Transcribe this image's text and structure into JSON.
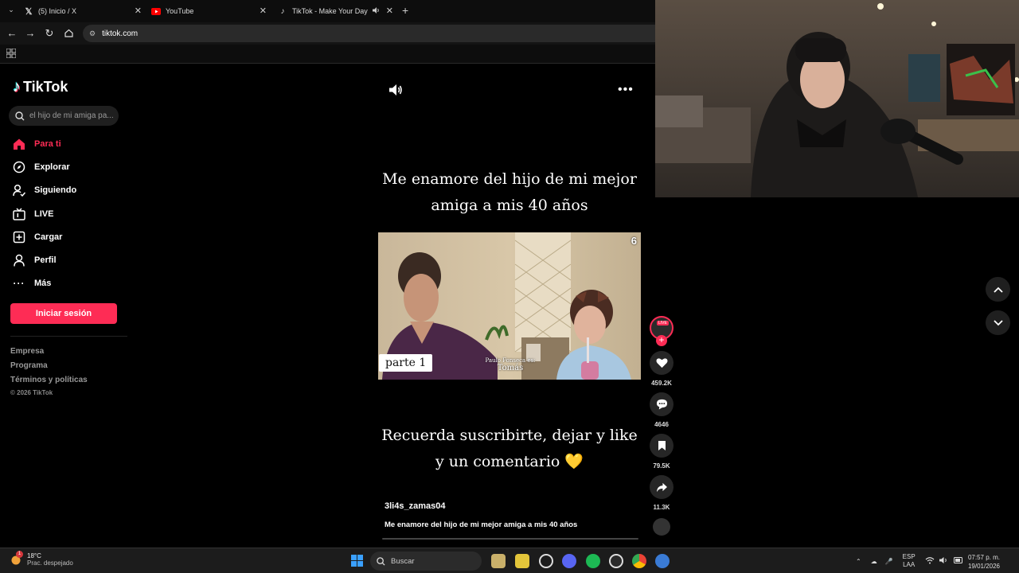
{
  "browser": {
    "tabs": [
      {
        "title": "(5) Inicio / X",
        "icon": "x-logo-icon"
      },
      {
        "title": "YouTube",
        "icon": "youtube-logo-icon"
      },
      {
        "title": "TikTok - Make Your Day",
        "icon": "tiktok-logo-icon",
        "active": true
      }
    ],
    "url": "tiktok.com"
  },
  "tiktok": {
    "brand": "TikTok",
    "search_placeholder": "el hijo de mi amiga pa...",
    "nav": [
      {
        "label": "Para ti",
        "icon": "home-icon",
        "active": true
      },
      {
        "label": "Explorar",
        "icon": "compass-icon"
      },
      {
        "label": "Siguiendo",
        "icon": "following-icon"
      },
      {
        "label": "LIVE",
        "icon": "live-tv-icon"
      },
      {
        "label": "Cargar",
        "icon": "upload-plus-icon"
      },
      {
        "label": "Perfil",
        "icon": "person-icon"
      },
      {
        "label": "Más",
        "icon": "more-dots-icon"
      }
    ],
    "login_label": "Iniciar sesión",
    "footer_links": [
      "Empresa",
      "Programa",
      "Términos y políticas"
    ],
    "copyright": "© 2026 TikTok"
  },
  "video": {
    "caption_top": "Me enamore del hijo de mi mejor amiga a mis 40 años",
    "caption_bottom": "Recuerda suscribirte, dejar y like y un comentario 💛",
    "part_label": "parte 1",
    "credit_line1": "Paulo Fonseca es:",
    "credit_line2": "Tomás",
    "channel_logo": "6",
    "username": "3li4s_zamas04",
    "description": "Me enamore del hijo de mi mejor amiga a mis 40 años",
    "avatar_badge": "LIVE",
    "likes": "459.2K",
    "comments": "4646",
    "saves": "79.5K",
    "shares": "11.3K"
  },
  "taskbar": {
    "temperature": "18°C",
    "weather": "Prac. despejado",
    "weather_badge": "1",
    "search_label": "Buscar",
    "language_top": "ESP",
    "language_bottom": "LAA",
    "time": "07:57 p. m.",
    "date": "19/01/2026"
  },
  "colors": {
    "tiktok_accent": "#fe2c55",
    "background": "#000000"
  }
}
